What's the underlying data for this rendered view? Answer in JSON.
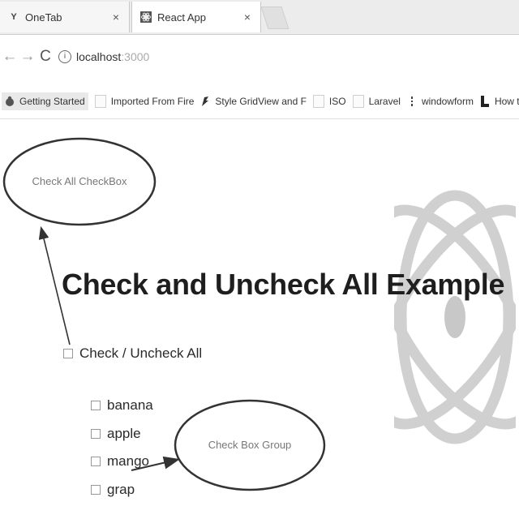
{
  "tabs": [
    {
      "title": "OneTab",
      "favicon": "onetab-icon",
      "close": "×"
    },
    {
      "title": "React App",
      "favicon": "react-app-icon",
      "close": "×"
    }
  ],
  "toolbar": {
    "back": "←",
    "forward": "→",
    "reload": "C",
    "host": "localhost",
    "port": ":3000"
  },
  "bookmarks": [
    {
      "label": "Getting Started",
      "icon": "getting-started-icon"
    },
    {
      "label": "Imported From Fire",
      "icon": "page-icon"
    },
    {
      "label": "Style GridView and F",
      "icon": "style-icon"
    },
    {
      "label": "ISO",
      "icon": "page-icon"
    },
    {
      "label": "Laravel",
      "icon": "page-icon"
    },
    {
      "label": "windowform",
      "icon": "windowform-icon"
    },
    {
      "label": "How to create mult",
      "icon": "bookmark-l-icon"
    }
  ],
  "page": {
    "heading": "Check and Uncheck All Example",
    "check_all_label": "Check / Uncheck All",
    "fruits": [
      "banana",
      "apple",
      "mango",
      "grap"
    ],
    "annotation_check_all": "Check All CheckBox",
    "annotation_group": "Check Box Group"
  },
  "colors": {
    "react_logo": "#d0d0d0",
    "annotation_stroke": "#333333"
  }
}
